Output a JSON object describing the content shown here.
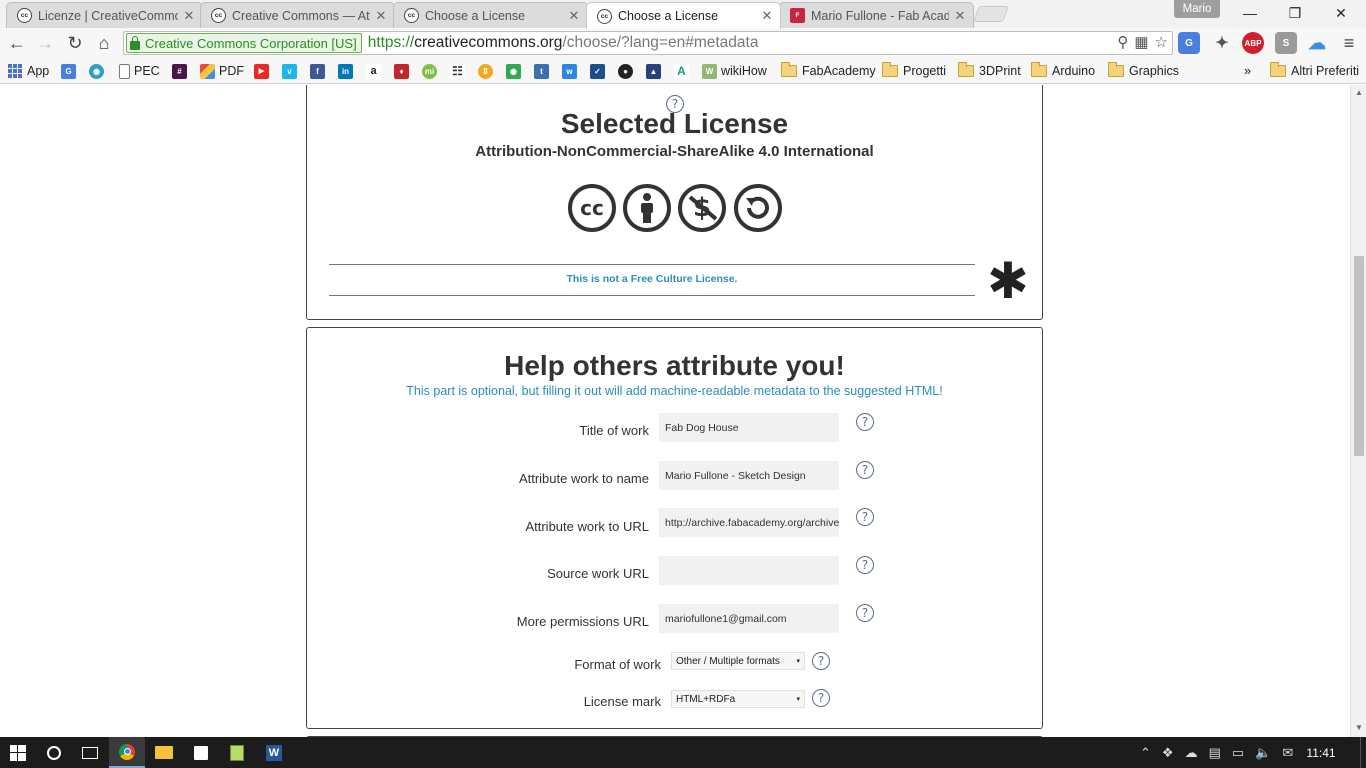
{
  "browser": {
    "tabs": [
      {
        "title": "Licenze | CreativeCommons",
        "icon": "cc-icon",
        "active": false
      },
      {
        "title": "Creative Commons — Attribution",
        "icon": "cc-icon",
        "active": false
      },
      {
        "title": "Choose a License",
        "icon": "cc-icon",
        "active": false
      },
      {
        "title": "Choose a License",
        "icon": "cc-icon",
        "active": true
      },
      {
        "title": "Mario Fullone - Fab Academy",
        "icon": "fabacademy-icon",
        "active": false
      }
    ],
    "profile_name": "Mario",
    "security_badge": "Creative Commons Corporation [US]",
    "url": {
      "scheme": "https://",
      "host": "creativecommons.org",
      "path": "/choose/?lang=en#metadata"
    },
    "bookmarks": [
      {
        "label": "App",
        "icon": "apps-grid-icon"
      },
      {
        "label": "",
        "icon": "google-translate-icon"
      },
      {
        "label": "",
        "icon": "photo-icon"
      },
      {
        "label": "PEC",
        "icon": "page-icon"
      },
      {
        "label": "",
        "icon": "slack-icon"
      },
      {
        "label": "PDF",
        "icon": "pdf-icon"
      },
      {
        "label": "",
        "icon": "youtube-icon"
      },
      {
        "label": "",
        "icon": "vimeo-icon"
      },
      {
        "label": "",
        "icon": "facebook-icon"
      },
      {
        "label": "",
        "icon": "linkedin-icon"
      },
      {
        "label": "",
        "icon": "amazon-icon"
      },
      {
        "label": "",
        "icon": "devil-icon"
      },
      {
        "label": "",
        "icon": "mi-icon"
      },
      {
        "label": "",
        "icon": "grid-icon"
      },
      {
        "label": "",
        "icon": "instructables-icon"
      },
      {
        "label": "",
        "icon": "green-icon"
      },
      {
        "label": "",
        "icon": "thingiverse-icon"
      },
      {
        "label": "",
        "icon": "w-icon"
      },
      {
        "label": "",
        "icon": "shield-icon"
      },
      {
        "label": "",
        "icon": "disc-icon"
      },
      {
        "label": "",
        "icon": "mountain-icon"
      },
      {
        "label": "",
        "icon": "a-icon"
      },
      {
        "label": "wikiHow",
        "icon": "wikihow-icon"
      },
      {
        "label": "FabAcademy",
        "icon": "folder-icon"
      },
      {
        "label": "Progetti",
        "icon": "folder-icon"
      },
      {
        "label": "3DPrint",
        "icon": "folder-icon"
      },
      {
        "label": "Arduino",
        "icon": "folder-icon"
      },
      {
        "label": "Graphics",
        "icon": "folder-icon"
      }
    ],
    "bookmarks_overflow": "»",
    "other_bookmarks": "Altri Preferiti"
  },
  "selected_license": {
    "help": "?",
    "title": "Selected License",
    "name": "Attribution-NonCommercial-ShareAlike 4.0 International",
    "icons": [
      "cc-icon",
      "by-icon",
      "nc-icon",
      "sa-icon"
    ],
    "cc_text": "cc",
    "free_culture_notice": "This is not a Free Culture License.",
    "asterisk": "✱"
  },
  "attribution": {
    "title": "Help others attribute you!",
    "subtitle": "This part is optional, but filling it out will add machine-readable metadata to the suggested HTML!",
    "help": "?",
    "fields": [
      {
        "label": "Title of work",
        "value": "Fab Dog House"
      },
      {
        "label": "Attribute work to name",
        "value": "Mario Fullone - Sketch Design"
      },
      {
        "label": "Attribute work to URL",
        "value": "http://archive.fabacademy.org/archives"
      },
      {
        "label": "Source work URL",
        "value": ""
      },
      {
        "label": "More permissions URL",
        "value": "mariofullone1@gmail.com"
      }
    ],
    "selects": [
      {
        "label": "Format of work",
        "value": "Other / Multiple formats"
      },
      {
        "label": "License mark",
        "value": "HTML+RDFa"
      }
    ]
  },
  "taskbar": {
    "clock": "11:41"
  },
  "colors": {
    "accent_link": "#2a8fb8",
    "ev_green": "#2b8d24",
    "text_dark": "#333333"
  }
}
